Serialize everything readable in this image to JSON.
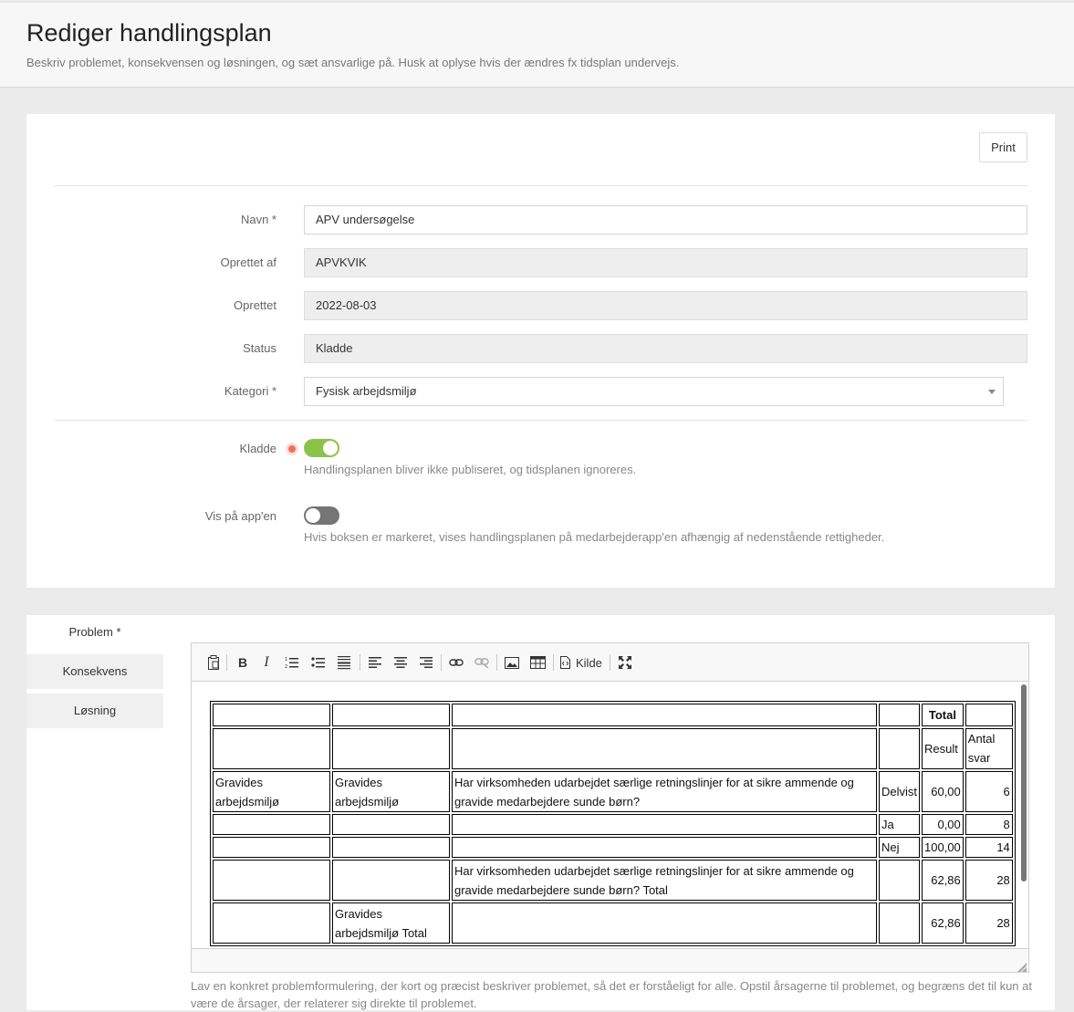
{
  "header": {
    "title": "Rediger handlingsplan",
    "subtitle": "Beskriv problemet, konsekvensen og løsningen, og sæt ansvarlige på. Husk at oplyse hvis der ændres fx tidsplan undervejs."
  },
  "actions": {
    "print_label": "Print"
  },
  "form": {
    "name": {
      "label": "Navn *",
      "value": "APV undersøgelse"
    },
    "created_by": {
      "label": "Oprettet af",
      "value": "APVKVIK"
    },
    "created": {
      "label": "Oprettet",
      "value": "2022-08-03"
    },
    "status": {
      "label": "Status",
      "value": "Kladde"
    },
    "category": {
      "label": "Kategori *",
      "value": "Fysisk arbejdsmiljø"
    },
    "draft": {
      "label": "Kladde",
      "on": true,
      "help": "Handlingsplanen bliver ikke publiseret, og tidsplanen ignoreres."
    },
    "show_in_app": {
      "label": "Vis på app'en",
      "on": false,
      "help": "Hvis boksen er markeret, vises handlingsplanen på medarbejderapp'en afhængig af nedenstående rettigheder."
    }
  },
  "tabs": [
    {
      "label": "Problem *",
      "active": true
    },
    {
      "label": "Konsekvens",
      "active": false
    },
    {
      "label": "Løsning",
      "active": false
    }
  ],
  "toolbar": {
    "source_label": "Kilde",
    "icons": [
      "paste-icon",
      "bold-icon",
      "italic-icon",
      "numbered-list-icon",
      "bullet-list-icon",
      "horizontal-rule-icon",
      "align-left-icon",
      "align-center-icon",
      "align-right-icon",
      "link-icon",
      "unlink-icon",
      "image-icon",
      "table-icon",
      "source-icon",
      "maximize-icon"
    ]
  },
  "table": {
    "rows": [
      [
        "",
        "",
        "",
        "",
        "Total",
        ""
      ],
      [
        "",
        "",
        "",
        "",
        "Result",
        "Antal svar"
      ],
      [
        "Gravides arbejdsmiljø",
        "Gravides arbejdsmiljø",
        "Har virksomheden udarbejdet særlige retningslinjer for at sikre ammende og gravide medarbejdere sunde børn?",
        "Delvist",
        "60,00",
        "6"
      ],
      [
        "",
        "",
        "",
        "Ja",
        "0,00",
        "8"
      ],
      [
        "",
        "",
        "",
        "Nej",
        "100,00",
        "14"
      ],
      [
        "",
        "",
        "Har virksomheden udarbejdet særlige retningslinjer for at sikre ammende og gravide medarbejdere sunde børn? Total",
        "",
        "62,86",
        "28"
      ],
      [
        "",
        "Gravides arbejdsmiljø Total",
        "",
        "",
        "62,86",
        "28"
      ]
    ]
  },
  "problem_help": "Lav en konkret problemformulering, der kort og præcist beskriver problemet, så det er forståeligt for alle. Opstil årsagerne til problemet, og begræns det til kun at være de årsager, der relaterer sig direkte til problemet."
}
